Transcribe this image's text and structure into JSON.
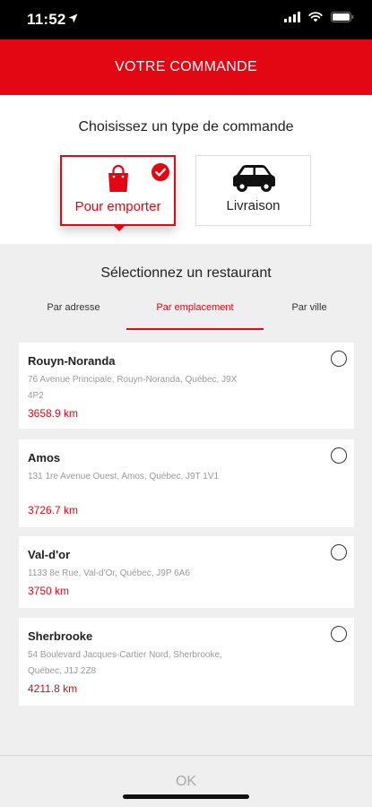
{
  "status_bar": {
    "time": "11:52"
  },
  "header": {
    "title": "VOTRE COMMANDE"
  },
  "order_type": {
    "title": "Choisissez un type de commande",
    "options": [
      {
        "label": "Pour emporter",
        "icon": "shopping-bag-icon",
        "selected": true
      },
      {
        "label": "Livraison",
        "icon": "car-icon",
        "selected": false
      }
    ]
  },
  "restaurant_select": {
    "title": "Sélectionnez un restaurant",
    "tabs": [
      {
        "label": "Par adresse",
        "active": false
      },
      {
        "label": "Par emplacement",
        "active": true
      },
      {
        "label": "Par ville",
        "active": false
      }
    ],
    "restaurants": [
      {
        "name": "Rouyn-Noranda",
        "address": "76 Avenue Principale, Rouyn-Noranda, Québec, J9X 4P2",
        "distance": "3658.9 km"
      },
      {
        "name": "Amos",
        "address": "131 1re Avenue Ouest, Amos, Québec, J9T 1V1",
        "distance": "3726.7 km"
      },
      {
        "name": "Val-d'or",
        "address": "1133 8e Rue, Val-d'Or, Québec, J9P 6A6",
        "distance": "3750 km"
      },
      {
        "name": "Sherbrooke",
        "address": "54 Boulevard Jacques-Cartier Nord, Sherbrooke, Québec, J1J 2Z8",
        "distance": "4211.8 km"
      }
    ]
  },
  "footer": {
    "ok_label": "OK"
  },
  "colors": {
    "brand_red": "#e30613",
    "background": "#efefef",
    "muted_text": "#9a9a9a"
  }
}
